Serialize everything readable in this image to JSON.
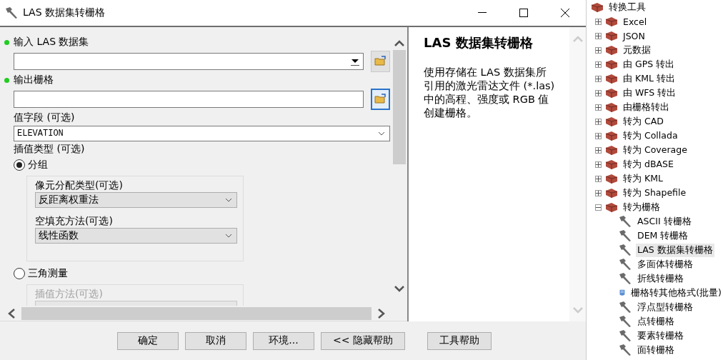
{
  "window": {
    "title": "LAS 数据集转栅格"
  },
  "form": {
    "fields": [
      {
        "kind": "combo",
        "label": "输入 LAS 数据集",
        "required": true,
        "browse_focused": false
      },
      {
        "kind": "text",
        "label": "输出栅格",
        "required": true,
        "browse_focused": true
      },
      {
        "kind": "select",
        "label": "值字段 (可选)",
        "required": false,
        "value": "ELEVATION"
      }
    ],
    "interpolation": {
      "label": "插值类型 (可选)",
      "options": [
        {
          "label": "分组",
          "selected": true,
          "params": [
            {
              "label": "像元分配类型(可选)",
              "value": "反距离权重法"
            },
            {
              "label": "空填充方法(可选)",
              "value": "线性函数"
            }
          ]
        },
        {
          "label": "三角测量",
          "selected": false,
          "params": [
            {
              "label": "插值方法(可选)"
            }
          ]
        }
      ]
    }
  },
  "help": {
    "title": "LAS 数据集转栅格",
    "text": "使用存储在 LAS 数据集所引用的激光雷达文件 (*.las) 中的高程、强度或 RGB 值创建栅格。"
  },
  "buttons": [
    "确定",
    "取消",
    "环境...",
    "<< 隐藏帮助",
    "工具帮助"
  ],
  "tree": {
    "label": "转换工具",
    "children": [
      {
        "label": "Excel",
        "expanded": false
      },
      {
        "label": "JSON",
        "expanded": false
      },
      {
        "label": "元数据",
        "expanded": false
      },
      {
        "label": "由 GPS 转出",
        "expanded": false
      },
      {
        "label": "由 KML 转出",
        "expanded": false
      },
      {
        "label": "由 WFS 转出",
        "expanded": false
      },
      {
        "label": "由栅格转出",
        "expanded": false
      },
      {
        "label": "转为 CAD",
        "expanded": false
      },
      {
        "label": "转为 Collada",
        "expanded": false
      },
      {
        "label": "转为 Coverage",
        "expanded": false
      },
      {
        "label": "转为 dBASE",
        "expanded": false
      },
      {
        "label": "转为 KML",
        "expanded": false
      },
      {
        "label": "转为 Shapefile",
        "expanded": false
      },
      {
        "label": "转为栅格",
        "expanded": true,
        "children": [
          {
            "label": "ASCII 转栅格",
            "kind": "tool",
            "selected": false
          },
          {
            "label": "DEM 转栅格",
            "kind": "tool",
            "selected": false
          },
          {
            "label": "LAS 数据集转栅格",
            "kind": "tool",
            "selected": true
          },
          {
            "label": "多面体转栅格",
            "kind": "tool",
            "selected": false
          },
          {
            "label": "折线转栅格",
            "kind": "tool",
            "selected": false
          },
          {
            "label": "栅格转其他格式(批量)",
            "kind": "script",
            "selected": false
          },
          {
            "label": "浮点型转栅格",
            "kind": "tool",
            "selected": false
          },
          {
            "label": "点转栅格",
            "kind": "tool",
            "selected": false
          },
          {
            "label": "要素转栅格",
            "kind": "tool",
            "selected": false
          },
          {
            "label": "面转栅格",
            "kind": "tool",
            "selected": false
          }
        ]
      }
    ]
  }
}
